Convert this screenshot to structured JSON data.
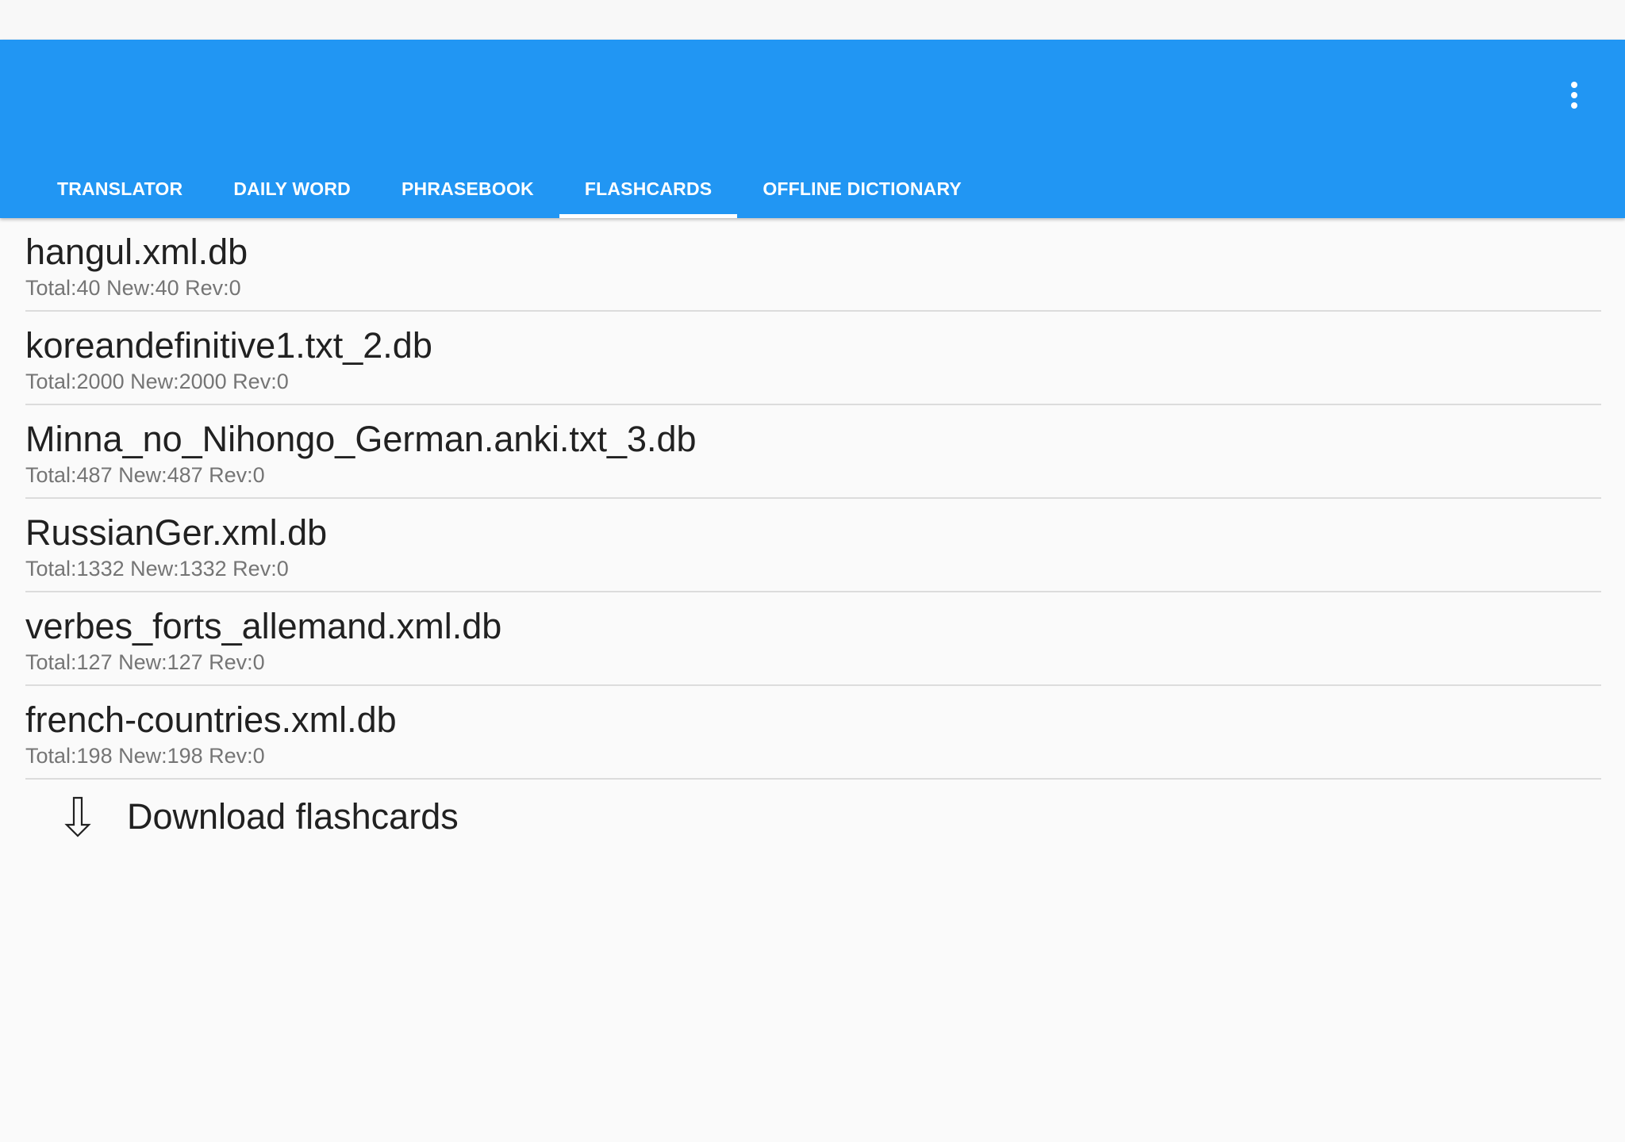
{
  "app_bar": {
    "overflow_icon": "more-vert-icon",
    "background_color": "#2196f3"
  },
  "tabs": [
    {
      "label": "TRANSLATOR",
      "active": false
    },
    {
      "label": "DAILY WORD",
      "active": false
    },
    {
      "label": "PHRASEBOOK",
      "active": false
    },
    {
      "label": "FLASHCARDS",
      "active": true
    },
    {
      "label": "OFFLINE DICTIONARY",
      "active": false
    }
  ],
  "decks": [
    {
      "name": "hangul.xml.db",
      "stats": "Total:40 New:40 Rev:0"
    },
    {
      "name": "koreandefinitive1.txt_2.db",
      "stats": "Total:2000 New:2000 Rev:0"
    },
    {
      "name": "Minna_no_Nihongo_German.anki.txt_3.db",
      "stats": "Total:487 New:487 Rev:0"
    },
    {
      "name": "RussianGer.xml.db",
      "stats": "Total:1332 New:1332 Rev:0"
    },
    {
      "name": "verbes_forts_allemand.xml.db",
      "stats": "Total:127 New:127 Rev:0"
    },
    {
      "name": "french-countries.xml.db",
      "stats": "Total:198 New:198 Rev:0"
    }
  ],
  "download": {
    "icon": "download-arrow-icon",
    "label": "Download flashcards"
  }
}
